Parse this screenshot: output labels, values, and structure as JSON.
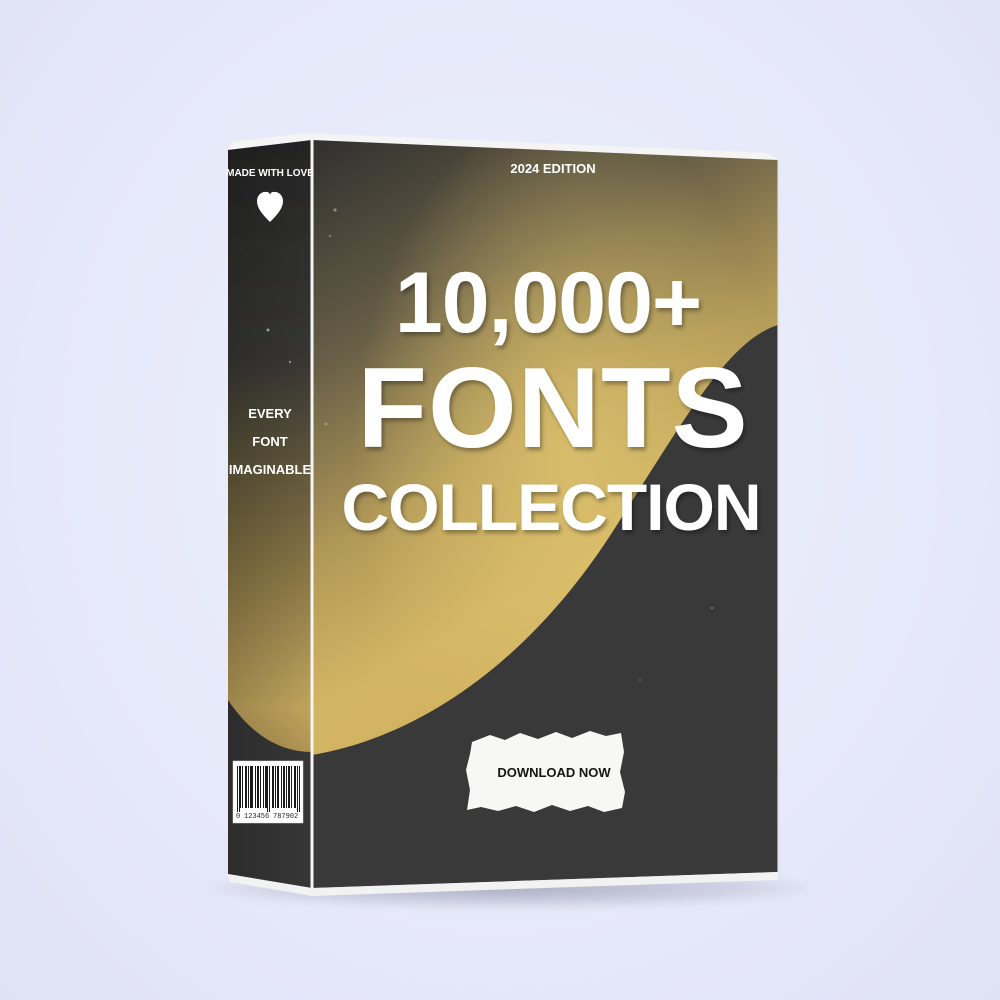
{
  "box": {
    "edition": "2024 EDITION",
    "headline_line1": "10,000+",
    "headline_line2": "FONTS",
    "headline_line3": "COLLECTION",
    "cta_label": "DOWNLOAD NOW",
    "side_top_label": "MADE WITH LOVE",
    "side_icon": "heart-icon",
    "side_line1": "EVERY",
    "side_line2": "FONT",
    "side_line3": "IMAGINABLE",
    "barcode_left_digit": "0",
    "barcode_digits_1": "123456",
    "barcode_digits_2": "787902"
  },
  "colors": {
    "background": "#e8ebfa",
    "box_dark": "#3a3a3a",
    "box_gold": "#d9b865",
    "text_light": "#ffffff",
    "text_dark": "#151515"
  }
}
